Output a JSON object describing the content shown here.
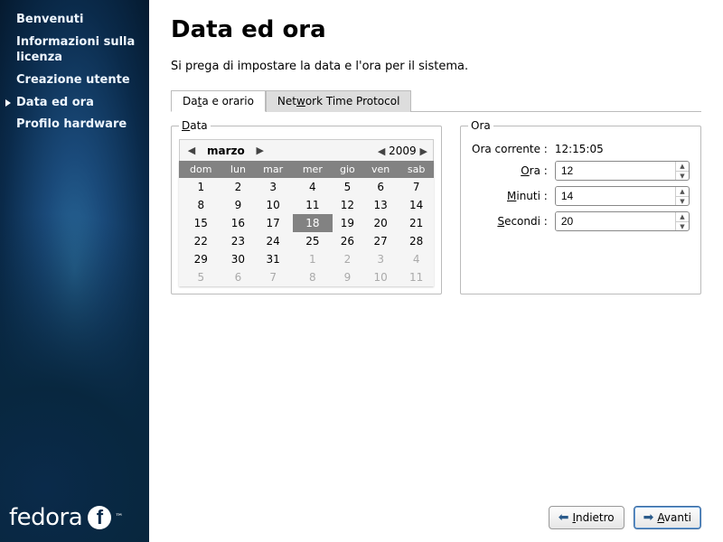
{
  "sidebar": {
    "items": [
      {
        "label": "Benvenuti"
      },
      {
        "label": "Informazioni sulla licenza"
      },
      {
        "label": "Creazione utente"
      },
      {
        "label": "Data ed ora"
      },
      {
        "label": "Profilo hardware"
      }
    ],
    "active_index": 3,
    "logo_text": "fedora",
    "logo_tm": "™",
    "logo_bubble": "f"
  },
  "page": {
    "title": "Data ed ora",
    "description": "Si prega di impostare la data e l'ora per il sistema."
  },
  "tabs": [
    {
      "label_pre": "Da",
      "label_u": "t",
      "label_post": "a e orario"
    },
    {
      "label_pre": "Net",
      "label_u": "w",
      "label_post": "ork Time Protocol"
    }
  ],
  "active_tab": 0,
  "calendar": {
    "legend_pre": "",
    "legend_u": "D",
    "legend_post": "ata",
    "month": "marzo",
    "year": "2009",
    "day_headers": [
      "dom",
      "lun",
      "mar",
      "mer",
      "gio",
      "ven",
      "sab"
    ],
    "weeks": [
      [
        {
          "d": "1"
        },
        {
          "d": "2"
        },
        {
          "d": "3"
        },
        {
          "d": "4"
        },
        {
          "d": "5"
        },
        {
          "d": "6"
        },
        {
          "d": "7"
        }
      ],
      [
        {
          "d": "8"
        },
        {
          "d": "9"
        },
        {
          "d": "10"
        },
        {
          "d": "11"
        },
        {
          "d": "12"
        },
        {
          "d": "13"
        },
        {
          "d": "14"
        }
      ],
      [
        {
          "d": "15"
        },
        {
          "d": "16"
        },
        {
          "d": "17"
        },
        {
          "d": "18",
          "sel": true
        },
        {
          "d": "19"
        },
        {
          "d": "20"
        },
        {
          "d": "21"
        }
      ],
      [
        {
          "d": "22"
        },
        {
          "d": "23"
        },
        {
          "d": "24"
        },
        {
          "d": "25"
        },
        {
          "d": "26"
        },
        {
          "d": "27"
        },
        {
          "d": "28"
        }
      ],
      [
        {
          "d": "29"
        },
        {
          "d": "30"
        },
        {
          "d": "31"
        },
        {
          "d": "1",
          "dim": true
        },
        {
          "d": "2",
          "dim": true
        },
        {
          "d": "3",
          "dim": true
        },
        {
          "d": "4",
          "dim": true
        }
      ],
      [
        {
          "d": "5",
          "dim": true
        },
        {
          "d": "6",
          "dim": true
        },
        {
          "d": "7",
          "dim": true
        },
        {
          "d": "8",
          "dim": true
        },
        {
          "d": "9",
          "dim": true
        },
        {
          "d": "10",
          "dim": true
        },
        {
          "d": "11",
          "dim": true
        }
      ]
    ]
  },
  "time": {
    "legend": "Ora",
    "current_label": "Ora corrente :",
    "current_value": "12:15:05",
    "hour_label_pre": "",
    "hour_label_u": "O",
    "hour_label_post": "ra :",
    "hour_value": "12",
    "minute_label_pre": "",
    "minute_label_u": "M",
    "minute_label_post": "inuti :",
    "minute_value": "14",
    "second_label_pre": "",
    "second_label_u": "S",
    "second_label_post": "econdi :",
    "second_value": "20"
  },
  "footer": {
    "back_pre": "",
    "back_u": "I",
    "back_post": "ndietro",
    "fwd_pre": "",
    "fwd_u": "A",
    "fwd_post": "vanti"
  }
}
